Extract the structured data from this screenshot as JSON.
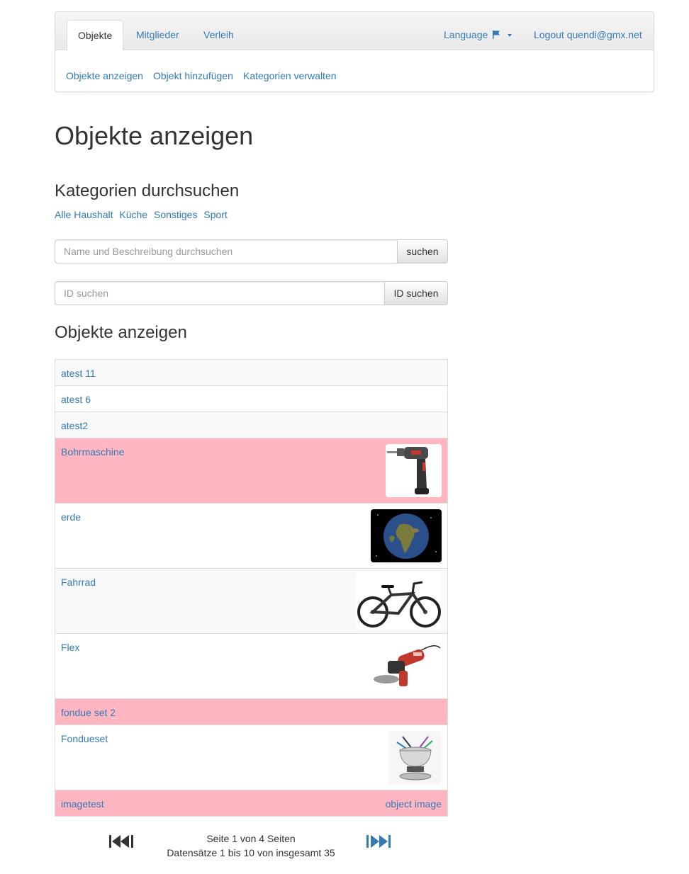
{
  "nav": {
    "tabs": [
      {
        "label": "Objekte",
        "active": true
      },
      {
        "label": "Mitglieder",
        "active": false
      },
      {
        "label": "Verleih",
        "active": false
      }
    ],
    "language": "Language",
    "logout": "Logout quendi@gmx.net",
    "subnav": [
      "Objekte anzeigen",
      "Objekt hinzufügen",
      "Kategorien verwalten"
    ]
  },
  "page_title": "Objekte anzeigen",
  "categories": {
    "heading": "Kategorien durchsuchen",
    "items": [
      "Alle Haushalt",
      "Küche",
      "Sonstiges",
      "Sport"
    ]
  },
  "search": {
    "placeholder": "Name und Beschreibung durchsuchen",
    "button": "suchen"
  },
  "id_search": {
    "placeholder": "ID suchen",
    "button": "ID suchen"
  },
  "list": {
    "heading": "Objekte anzeigen",
    "items": [
      {
        "name": "atest 11",
        "highlight": false,
        "image": "none"
      },
      {
        "name": "atest 6",
        "highlight": false,
        "image": "none"
      },
      {
        "name": "atest2",
        "highlight": false,
        "image": "none"
      },
      {
        "name": "Bohrmaschine",
        "highlight": true,
        "image": "drill"
      },
      {
        "name": "erde",
        "highlight": false,
        "image": "earth"
      },
      {
        "name": "Fahrrad",
        "highlight": false,
        "image": "bicycle"
      },
      {
        "name": "Flex",
        "highlight": false,
        "image": "angle-grinder"
      },
      {
        "name": "fondue set 2",
        "highlight": true,
        "image": "none"
      },
      {
        "name": "Fondueset",
        "highlight": false,
        "image": "fondue-pot"
      },
      {
        "name": "imagetest",
        "highlight": true,
        "image": "broken",
        "image_alt": "object image"
      }
    ]
  },
  "pagination": {
    "page_info": "Seite 1 von 4 Seiten",
    "records_info": "Datensätze 1 bis 10 von insgesamt 35"
  },
  "colors": {
    "link": "#337ab7",
    "highlight_row": "#ffb6c1",
    "stripe_row": "#f9f9f9"
  }
}
